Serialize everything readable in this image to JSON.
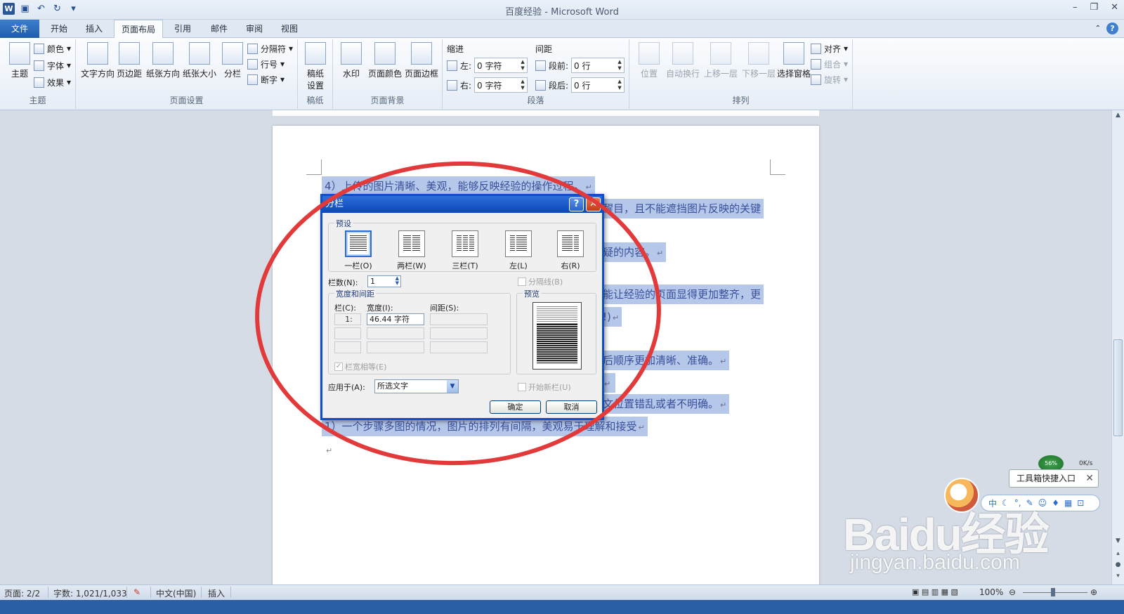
{
  "app": {
    "title_doc": "百度经验",
    "title_app": "Microsoft Word"
  },
  "tabs": [
    "文件",
    "开始",
    "插入",
    "页面布局",
    "引用",
    "邮件",
    "审阅",
    "视图"
  ],
  "ribbon": {
    "theme": {
      "label": "主题",
      "big": "主题",
      "colors": "颜色",
      "fonts": "字体",
      "effects": "效果"
    },
    "page_setup": {
      "label": "页面设置",
      "text_dir": "文字方向",
      "margins": "页边距",
      "orientation": "纸张方向",
      "size": "纸张大小",
      "columns": "分栏",
      "breaks": "分隔符",
      "line_numbers": "行号",
      "hyphenation": "断字"
    },
    "draft": {
      "label": "稿纸",
      "btn": "稿纸\n设置"
    },
    "background": {
      "label": "页面背景",
      "watermark": "水印",
      "color": "页面颜色",
      "border": "页面边框"
    },
    "paragraph": {
      "label": "段落",
      "indent": "缩进",
      "spacing": "间距",
      "left": "左:",
      "right": "右:",
      "left_val": "0 字符",
      "right_val": "0 字符",
      "before": "段前:",
      "after": "段后:",
      "before_val": "0 行",
      "after_val": "0 行"
    },
    "arrange": {
      "label": "排列",
      "position": "位置",
      "wrap": "自动换行",
      "forward": "上移一层",
      "backward": "下移一层",
      "pane": "选择窗格",
      "align": "对齐",
      "group": "组合",
      "rotate": "旋转"
    }
  },
  "document": {
    "lines": [
      "4）上传的图片清晰、美观，能够反映经验的操作过程。",
      "醒目，且不能遮挡图片反映的关键",
      "疑的内容。",
      "能让经验的页面显得更加整齐，更",
      "!)",
      "后顺序更加清晰、准确。",
      "",
      "文位置错乱或者不明确。",
      "1）一个步骤多图的情况，图片的排列有间隔，美观易于理解和接受"
    ]
  },
  "dialog": {
    "title": "分栏",
    "presets_label": "预设",
    "presets": [
      "一栏(O)",
      "两栏(W)",
      "三栏(T)",
      "左(L)",
      "右(R)"
    ],
    "num_cols_label": "栏数(N):",
    "num_cols_value": "1",
    "divider_label": "分隔线(B)",
    "width_spacing_label": "宽度和间距",
    "col_header": "栏(C):",
    "width_header": "宽度(I):",
    "spacing_header": "间距(S):",
    "row1_col": "1:",
    "row1_width": "46.44 字符",
    "equal_width_label": "栏宽相等(E)",
    "preview_label": "预览",
    "apply_label": "应用于(A):",
    "apply_value": "所选文字",
    "new_col_label": "开始新栏(U)",
    "ok": "确定",
    "cancel": "取消"
  },
  "status": {
    "page": "页面: 2/2",
    "words": "字数: 1,021/1,033",
    "language": "中文(中国)",
    "mode": "插入",
    "zoom": "100%"
  },
  "overlay": {
    "toolbox": "工具箱快捷入口",
    "ime": "中",
    "net_percent": "56%",
    "net_speed": "0K/s"
  },
  "watermark": {
    "main": "Baidu经验",
    "sub": "jingyan.baidu.com"
  },
  "colors": {
    "annotation": "#e23a3a",
    "selection": "#b5c8e9",
    "dialog_border": "#0e4fc5"
  }
}
